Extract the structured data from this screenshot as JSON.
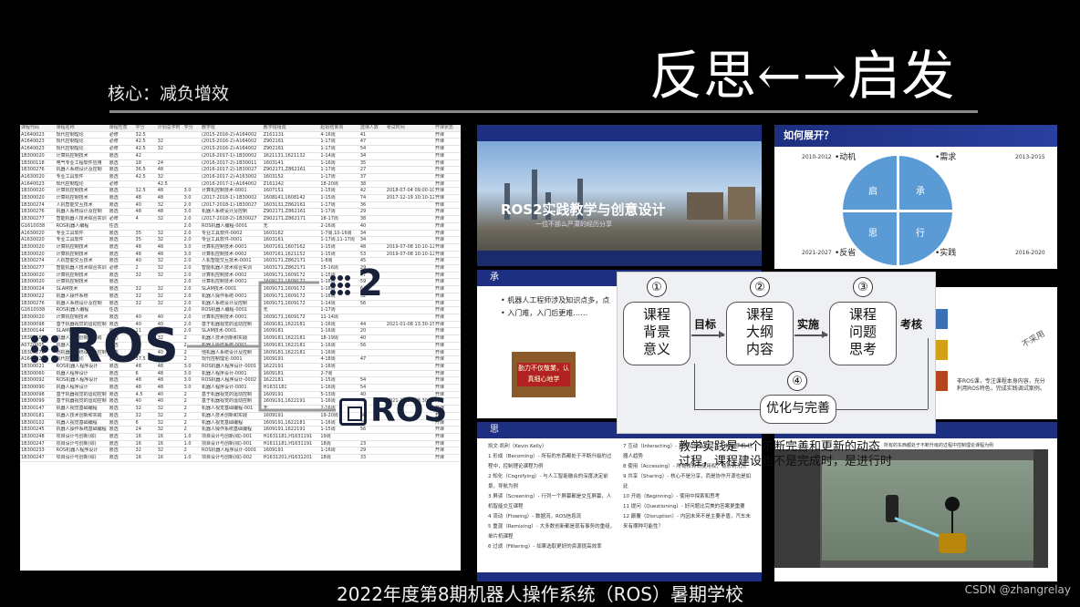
{
  "header": {
    "title": "反思←→启发",
    "subtitle": "核心：减负增效"
  },
  "footer": "2022年度第8期机器人操作系统（ROS）暑期学校",
  "watermark": "CSDN @zhangrelay",
  "table": {
    "columns": [
      "课程代码",
      "课程名称",
      "课程性质",
      "学分",
      "计划总学时",
      "学分",
      "教学班",
      "教学班组成",
      "起始结束周",
      "选课人数",
      "考试时间",
      "开课状态"
    ],
    "rows": [
      [
        "A1640023",
        "现代控制理论",
        "必修",
        "32.5",
        "",
        "",
        "(2015-2016-2)-A164002",
        "Z161131",
        "4-16周",
        "41",
        "",
        "开课"
      ],
      [
        "A1640023",
        "现代控制理论",
        "必修",
        "42.5",
        "32",
        "",
        "(2015-2016-2)-A164002",
        "Z902161",
        "1-17周",
        "47",
        "",
        "开课"
      ],
      [
        "A1640023",
        "现代控制理论",
        "必修",
        "42.5",
        "32",
        "",
        "(2015-2016-2)-A164002",
        "Z902161",
        "1-17周",
        "54",
        "",
        "开课"
      ],
      [
        "1B300020",
        "计算机控制技术",
        "限选",
        "42",
        "",
        "",
        "(2016-2017-1)-1B30002",
        "1621131,1621132",
        "1-14周",
        "34",
        "",
        "开课"
      ],
      [
        "1B300118",
        "电气专业工程软件应用",
        "限选",
        "18",
        "24",
        "",
        "(2016-2017-2)-1B30011",
        "1603141",
        "1-16周",
        "35",
        "",
        "开课"
      ],
      [
        "1B300276",
        "机器人系统设计及控制",
        "限选",
        "36.5",
        "48",
        "",
        "(2016-2017-2)-1B30027",
        "Z902171,Z862161",
        "1-17周",
        "27",
        "",
        "开课"
      ],
      [
        "A1630020",
        "专业工具软件",
        "限选",
        "42.5",
        "32",
        "",
        "(2016-2017-2)-A163002",
        "1603152",
        "1-17周",
        "37",
        "",
        "开课"
      ],
      [
        "A1640023",
        "现代控制理论",
        "必修",
        "",
        "42.5",
        "",
        "(2016-2017-1)-A164002",
        "Z161142",
        "18-20周",
        "38",
        "",
        "开课"
      ],
      [
        "1B300020",
        "计算机控制技术",
        "限选",
        "32.5",
        "48",
        "3.0",
        "计算机控制技术-0001",
        "1607151",
        "1-15周",
        "42",
        "2018-07-04 09:00-10:00",
        "开课"
      ],
      [
        "1B300020",
        "计算机控制技术",
        "限选",
        "48",
        "48",
        "3.0",
        "(2017-2018-1)-1B30002",
        "1608141,1608142",
        "1-15周",
        "74",
        "2017-12-19 10:10-12:10",
        "开课"
      ],
      [
        "1B300274",
        "人机智能交互技术",
        "限选",
        "40",
        "32",
        "2.0",
        "(2017-2018-1)-1B30027",
        "1603131,Z862161",
        "1-17周",
        "36",
        "",
        "开课"
      ],
      [
        "1B300276",
        "机器人系统设计及控制",
        "限选",
        "48",
        "48",
        "3.0",
        "机器人系统设计及控制",
        "Z902171,Z862161",
        "1-17周",
        "29",
        "",
        "开课"
      ],
      [
        "1B300277",
        "智能机器人技术综合实训",
        "必修",
        "4",
        "32",
        "2.0",
        "(2017-2018-2)-1B30027",
        "Z902171,Z862171",
        "18-17周",
        "38",
        "",
        "开课"
      ],
      [
        "G1610038",
        "ROS机器人编程",
        "任选",
        "",
        "",
        "2.0",
        "ROS机器人编程-0001",
        "无",
        "2-16周",
        "40",
        "",
        "开课"
      ],
      [
        "A1630020",
        "专业工具软件",
        "限选",
        "35",
        "32",
        "2.0",
        "专业工具软件-0002",
        "1603162",
        "1-7周,10-16周",
        "34",
        "",
        "开课"
      ],
      [
        "A1630020",
        "专业工具软件",
        "限选",
        "35",
        "32",
        "2.0",
        "专业工具软件-0001",
        "1603161",
        "1-17周,11-17周",
        "34",
        "",
        "开课"
      ],
      [
        "1B300020",
        "计算机控制技术",
        "限选",
        "48",
        "48",
        "3.0",
        "计算机控制技术-0001",
        "1607161,1607162",
        "1-15周",
        "48",
        "2019-07-08 10:10-12:10",
        "开课"
      ],
      [
        "1B300020",
        "计算机控制技术",
        "限选",
        "48",
        "48",
        "3.0",
        "计算机控制技术-0002",
        "1607161,1621152",
        "1-15周",
        "53",
        "2019-07-08 10:10-12:10",
        "开课"
      ],
      [
        "1B300274",
        "人机智能交互技术",
        "限选",
        "40",
        "32",
        "2.0",
        "人机智能交互技术-0001",
        "1603171,Z862171",
        "1-8周",
        "45",
        "",
        "开课"
      ],
      [
        "1B300277",
        "智能机器人技术综合实训",
        "必修",
        "2",
        "32",
        "2.0",
        "智能机器人技术综合实训",
        "1603171,Z862171",
        "15-16周",
        "29",
        "",
        "开课"
      ],
      [
        "1B300020",
        "计算机控制技术",
        "限选",
        "32",
        "32",
        "2.0",
        "计算机控制技术-0002",
        "1609171,1609172",
        "1-15周",
        "47",
        "",
        "开课"
      ],
      [
        "1B300020",
        "计算机控制技术",
        "限选",
        "",
        "",
        "2.0",
        "计算机控制技术-0001",
        "1609171,1609172",
        "1-16周",
        "59",
        "",
        "开课"
      ],
      [
        "1B300024",
        "SLAM技术",
        "限选",
        "32",
        "32",
        "2.0",
        "SLAM技术-0001",
        "1609171,1609172",
        "1-16周",
        "64",
        "",
        "开课"
      ],
      [
        "1B300022",
        "机器人操作系统",
        "限选",
        "32",
        "32",
        "2.0",
        "机器人操作系统-0001",
        "1609171,1609172",
        "1-16周",
        "32",
        "",
        "开课"
      ],
      [
        "1B300276",
        "机器人系统设计及控制",
        "限选",
        "32",
        "32",
        "2.0",
        "机器人系统设计及控制",
        "1609171,1609172",
        "1-14周",
        "56",
        "",
        "开课"
      ],
      [
        "G1610038",
        "ROS机器人编程",
        "任选",
        "",
        "",
        "2.0",
        "ROS机器人编程-0001",
        "无",
        "1-17周",
        "",
        "",
        "开课"
      ],
      [
        "1B300020",
        "计算机控制技术",
        "限选",
        "40",
        "40",
        "2.0",
        "计算机控制技术-0001",
        "1609171,1609172",
        "11-14周",
        "",
        "",
        "开课"
      ],
      [
        "1B300098",
        "基于机器视觉的运动控制",
        "限选",
        "40",
        "40",
        "2.0",
        "基于机器视觉的运动控制",
        "1609181,1622181",
        "1-16周",
        "44",
        "2021-01-08 13:30-15:30",
        "开课"
      ],
      [
        "1B300144",
        "SLAM技术",
        "限选",
        "11",
        "",
        "2.0",
        "SLAM技术-0001",
        "1609181",
        "1-16周",
        "20",
        "",
        "开课"
      ],
      [
        "1B300181",
        "机器人技术创新和实践",
        "限选",
        "32",
        "32",
        "2",
        "机器人技术创新和实践",
        "1609181,1622181",
        "18-19周",
        "40",
        "",
        "开课"
      ],
      [
        "A0720005",
        "机器人操作系统",
        "限选",
        "32",
        "40",
        "2",
        "机器人操作系统-0001",
        "1609181,1622181",
        "1-16周",
        "56",
        "",
        "开课"
      ],
      [
        "1B300276",
        "他机器人系统设计及控制",
        "限选",
        "32",
        "40",
        "2",
        "他机器人系统设计及控制",
        "1609181,1622181",
        "1-16周",
        "",
        "",
        "开课"
      ],
      [
        "A1640023",
        "现代控制理论",
        "必修",
        "37.5",
        "32",
        "2",
        "现代控制理论-0001",
        "1609191",
        "4-18周",
        "47",
        "",
        "开课"
      ],
      [
        "1B300021",
        "ROS机器人程序设计",
        "限选",
        "48",
        "48",
        "3.0",
        "ROS机器人程序设计-0001",
        "1622191",
        "1-16周",
        "",
        "",
        "开课"
      ],
      [
        "1B300060",
        "机器人程序设计",
        "限选",
        "6",
        "48",
        "3.0",
        "机器人程序设计-0001",
        "1609181",
        "2-7周",
        "",
        "",
        "开课"
      ],
      [
        "1B300092",
        "ROS机器人程序设计",
        "限选",
        "48",
        "48",
        "3.0",
        "ROS机器人程序设计-0002",
        "1622181",
        "1-15周",
        "54",
        "",
        "开课"
      ],
      [
        "1B300090",
        "机器人程序设计",
        "限选",
        "48",
        "48",
        "3.0",
        "机器人程序设计-0001",
        "H1631181",
        "1-16周",
        "54",
        "",
        "开课"
      ],
      [
        "1B300098",
        "基于机器视觉的运动控制",
        "限选",
        "4.5",
        "40",
        "2",
        "基于机器视觉的运动控制",
        "1609191",
        "5-13周",
        "40",
        "",
        "开课"
      ],
      [
        "1B300099",
        "基于机器视觉的运动控制",
        "限选",
        "40",
        "40",
        "2",
        "基于机器视觉的运动控制",
        "1609191,1622191",
        "1-16周",
        "41",
        "2021-12-27 13:30-15:30",
        "开课"
      ],
      [
        "1B300147",
        "机器人视觉基础编程",
        "限选",
        "32",
        "32",
        "2",
        "机器人视觉基础编程-001",
        "无",
        "2-16周",
        "",
        "",
        "开课"
      ],
      [
        "1B300181",
        "机器人技术创新和实践",
        "限选",
        "32",
        "32",
        "2",
        "机器人技术创新和实践",
        "1609191",
        "19-20周",
        "40",
        "",
        "开课"
      ],
      [
        "1B300102",
        "机器人视觉基础编程",
        "限选",
        "6",
        "32",
        "2",
        "机器人视觉基础编程",
        "1609191,1622181",
        "1-16周",
        "29",
        "",
        "开课"
      ],
      [
        "1B300245",
        "机器人操作系统基础编程",
        "限选",
        "24",
        "32",
        "2",
        "机器人操作系统基础编程",
        "1609191,1622191",
        "1-15周",
        "56",
        "",
        "开课"
      ],
      [
        "1B300248",
        "项目设计与创新(综)",
        "限选",
        "16",
        "16",
        "1.0",
        "项目设计与创新(综)-001",
        "H1631181,H1631191",
        "19周",
        "",
        "",
        "开课"
      ],
      [
        "1B300247",
        "项目设计与创新(综)",
        "限选",
        "16",
        "16",
        "1.0",
        "项目设计与创新(综)-001",
        "H1611181,H1631191",
        "18周",
        "23",
        "",
        "开课"
      ],
      [
        "1B300233",
        "ROS机器人程序设计",
        "限选",
        "32",
        "32",
        "2",
        "ROS机器人程序设计-0001",
        "1609191",
        "1-16周",
        "29",
        "",
        "开课"
      ],
      [
        "1B300247",
        "项目设计与创新(综)",
        "限选",
        "16",
        "16",
        "1.0",
        "项目设计与创新(综)-002",
        "H1631201,H1631201",
        "18周",
        "33",
        "",
        "开课"
      ]
    ]
  },
  "logos": {
    "ros_big": "ROS",
    "ros2_number": "2",
    "ros_chip": "ROS"
  },
  "slide_cover": {
    "title": "ROS2实践教学与创意设计",
    "subtitle": "一位不那么严肃的经历分享"
  },
  "slide_expand": {
    "header": "如何展开？",
    "labels": {
      "tl": "•动机",
      "tr": "•需求",
      "bl": "•反省",
      "br": "•实践"
    },
    "years": {
      "tl": "2010-2012",
      "tr": "2013-2015",
      "bl": "2021-2027",
      "br": "2016-2020"
    },
    "quadrants": [
      "启",
      "承",
      "思",
      "行"
    ]
  },
  "slide_cheng": {
    "header": "承",
    "bullets": [
      "• 机器人工程师涉及知识点多，点",
      "• 入门难，入门后更难……"
    ],
    "sign_text": "勤力不仅敬業，认真细心地学"
  },
  "slide_right_mid": {
    "stamp": "不采用",
    "text": "非ROS课，专注课程本身内容，充分利用ROS特色，完成实践调试案例。"
  },
  "slide_si": {
    "header": "思",
    "col1": [
      "凯文·凯利（Kevin Kelly）",
      "1 形成（Becoming）- 所有的东西都处于不断升级的过程中，控制理论课程为例",
      "2 知化（Cognifying）- 与人工智能融合的深度决定前景，导航为例",
      "3 屏读（Screening）- 行列一个屏幕都是交互屏幕，人机智能交互课程",
      "4 流动（Flowing）- 数据流，ROS信息流",
      "5 重混（Remixing）- 大多数创新都是现有事务的重组，单片机课程",
      "6 过滤（Filtering）- 如果选取更好的资源提高效率"
    ],
    "col2": [
      "7 互动（Interacting）- 与周边设备的交互，电脑-手机-机器人趋势",
      "8 使用（Accessing）- 所有权转向使用权，有形到无形",
      "9 共享（Sharing）- 核心不是分享，而是协作开源也是如此",
      "10 开始（Beginning）- 使用中探索和思考",
      "11 提问（Questioning）- 好问题比完美的答案更重要",
      "12 颠覆（Disruption）- 内因未来不是主要矛盾，汽车未来有哪种可能性？"
    ],
    "footer_tag": "2022 暑期学校"
  },
  "slide_sim": {
    "caption": "所有的东西都处于不断升级的过程中控制理论课程为例"
  },
  "overlay": {
    "lines": [
      "教学实践是一个不断完善和更新的动态",
      "过程，课程建设也不是完成时，是进行时"
    ]
  },
  "process": {
    "boxes": [
      {
        "num": "①",
        "lines": [
          "课程",
          "背景",
          "意义"
        ]
      },
      {
        "num": "②",
        "lines": [
          "课程",
          "大纲",
          "内容"
        ]
      },
      {
        "num": "③",
        "lines": [
          "课程",
          "问题",
          "思考"
        ]
      }
    ],
    "arrows": [
      "目标",
      "实施",
      "考核"
    ],
    "loop": {
      "num": "④",
      "label": "优化与完善"
    }
  }
}
